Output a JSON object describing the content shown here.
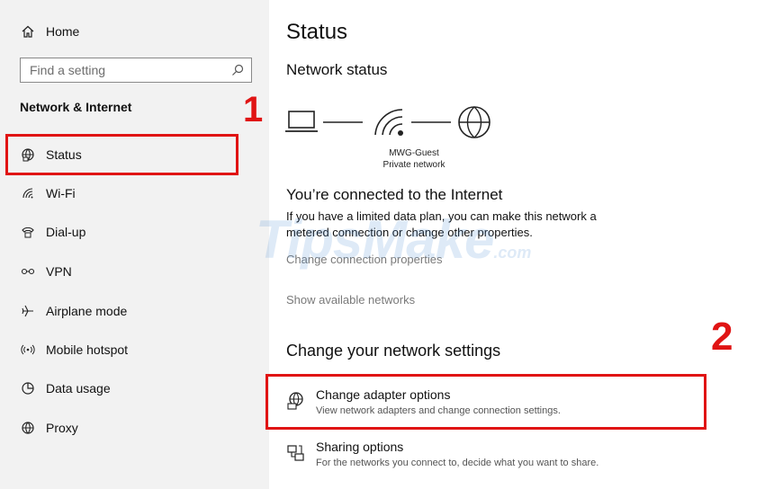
{
  "sidebar": {
    "home_label": "Home",
    "search_placeholder": "Find a setting",
    "section_title": "Network & Internet",
    "items": [
      {
        "label": "Status",
        "icon": "globe-grid-icon"
      },
      {
        "label": "Wi-Fi",
        "icon": "wifi-icon"
      },
      {
        "label": "Dial-up",
        "icon": "phone-icon"
      },
      {
        "label": "VPN",
        "icon": "vpn-icon"
      },
      {
        "label": "Airplane mode",
        "icon": "airplane-icon"
      },
      {
        "label": "Mobile hotspot",
        "icon": "hotspot-icon"
      },
      {
        "label": "Data usage",
        "icon": "pie-chart-icon"
      },
      {
        "label": "Proxy",
        "icon": "globe-icon"
      }
    ]
  },
  "main": {
    "title": "Status",
    "network_status_heading": "Network status",
    "network_name": "MWG-Guest",
    "network_type": "Private network",
    "connected_heading": "You’re connected to the Internet",
    "connected_text": "If you have a limited data plan, you can make this network a metered connection or change other properties.",
    "link_change_properties": "Change connection properties",
    "link_show_networks": "Show available networks",
    "settings_heading": "Change your network settings",
    "settings": [
      {
        "title": "Change adapter options",
        "desc": "View network adapters and change connection settings.",
        "icon": "adapter-globe-icon"
      },
      {
        "title": "Sharing options",
        "desc": "For the networks you connect to, decide what you want to share.",
        "icon": "sharing-icon"
      }
    ]
  },
  "annotations": {
    "marker_1": "1",
    "marker_2": "2",
    "color": "#e01414"
  },
  "watermark": {
    "main": "TipsMake",
    "suffix": ".com"
  }
}
